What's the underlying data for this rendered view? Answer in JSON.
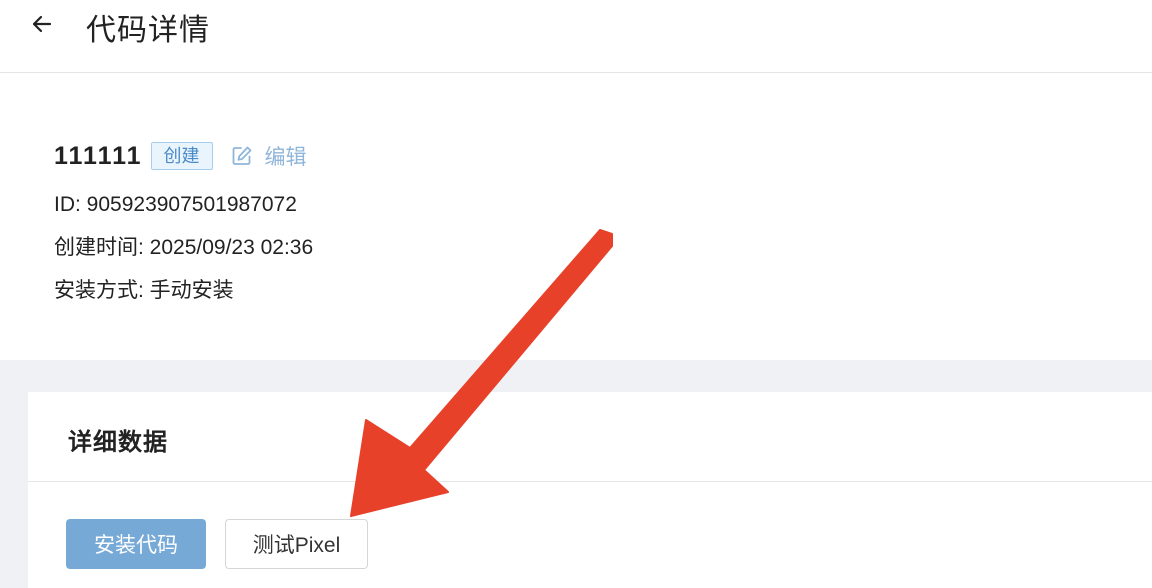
{
  "header": {
    "title": "代码详情",
    "back_icon": "arrow-left-icon"
  },
  "info": {
    "name": "111111",
    "status_badge": "创建",
    "edit_label": "编辑",
    "edit_icon": "edit-icon",
    "id_line": "ID: 905923907501987072",
    "created_line": "创建时间: 2025/09/23 02:36",
    "install_method_line": "安装方式: 手动安装"
  },
  "detail_card": {
    "title": "详细数据",
    "install_button": "安装代码",
    "test_button": "测试Pixel"
  },
  "colors": {
    "primary_button": "#77a9d6",
    "badge_text": "#4a8bc9",
    "badge_bg": "#eaf4fc",
    "edit_link": "#8fb6da",
    "annotation_arrow": "#e8412a",
    "gray_background": "#f0f1f4"
  }
}
